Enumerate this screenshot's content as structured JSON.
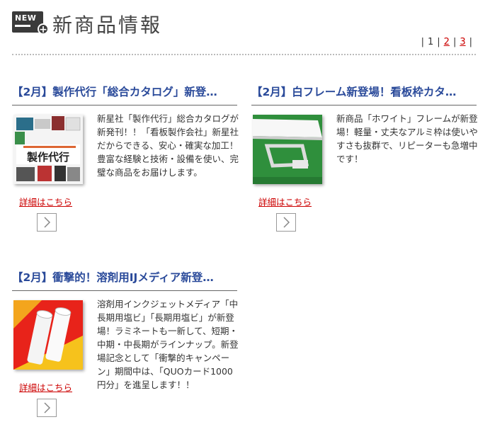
{
  "header": {
    "icon_label": "NEW",
    "title": "新商品情報"
  },
  "pagination": {
    "current": "1",
    "pages": [
      "2",
      "3"
    ]
  },
  "items": [
    {
      "title": "【2月】製作代行「総合カタログ」新登…",
      "thumb_text": "製作代行",
      "description": "新星社「製作代行」総合カタログが新発刊！！「看板製作会社」新星社だからできる、安心・確実な加工！豊富な経験と技術・設備を使い、完璧な商品をお届けします。",
      "more_label": "詳細はこちら"
    },
    {
      "title": "【2月】白フレーム新登場！看板枠カタ…",
      "description": "新商品「ホワイト」フレームが新登場！軽量・丈夫なアルミ枠は使いやすさも抜群で、リピーターも急増中です！",
      "more_label": "詳細はこちら"
    },
    {
      "title": "【2月】衝撃的！溶剤用IJメディア新登…",
      "description": "溶剤用インクジェットメディア「中長期用塩ビ」「長期用塩ビ」が新登場！ラミネートも一新して、短期・中期・中長期がラインナップ。新登場記念として「衝撃的キャンペーン」期間中は、「QUOカード1000円分」を進呈します！！",
      "more_label": "詳細はこちら"
    }
  ]
}
